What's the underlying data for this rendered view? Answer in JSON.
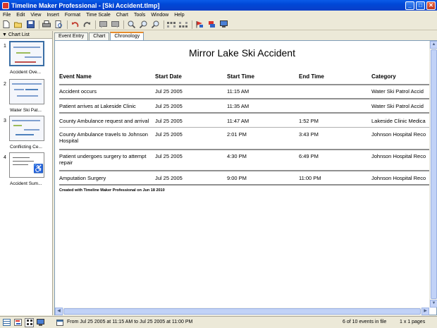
{
  "window": {
    "title": "Timeline Maker Professional - [Ski Accident.tlmp]",
    "buttons": [
      "_",
      "□",
      "✕"
    ]
  },
  "menu": [
    "File",
    "Edit",
    "View",
    "Insert",
    "Format",
    "Time Scale",
    "Chart",
    "Tools",
    "Window",
    "Help"
  ],
  "toolbar": {
    "icons": [
      "new-file-icon",
      "open-folder-icon",
      "save-icon",
      "print-icon",
      "print-preview-icon",
      "undo-icon",
      "redo-icon",
      "comment-icon",
      "comment-delete-icon",
      "search-icon",
      "zoom-in-icon",
      "zoom-out-icon",
      "expand-rows-icon",
      "collapse-rows-icon",
      "flag-icon",
      "export-icon",
      "monitor-icon"
    ]
  },
  "chart_list": {
    "header": "Chart List",
    "items": [
      {
        "num": "1",
        "label": "Accident Ove...",
        "selected": true
      },
      {
        "num": "2",
        "label": "Water Ski Pat...",
        "selected": false
      },
      {
        "num": "3",
        "label": "Conflicting Ce...",
        "selected": false
      },
      {
        "num": "4",
        "label": "Accident Sum...",
        "selected": false
      }
    ]
  },
  "tabs": [
    {
      "label": "Event Entry",
      "active": false
    },
    {
      "label": "Chart",
      "active": false
    },
    {
      "label": "Chronology",
      "active": true
    }
  ],
  "document": {
    "title": "Mirror Lake Ski Accident",
    "columns": [
      "Event Name",
      "Start Date",
      "Start Time",
      "End Time",
      "Category"
    ],
    "rows": [
      [
        "Accident occurs",
        "Jul 25 2005",
        "11:15 AM",
        "",
        "Water Ski Patrol Accid"
      ],
      [
        "Patient arrives at Lakeside Clinic",
        "Jul 25 2005",
        "11:35 AM",
        "",
        "Water Ski Patrol Accid"
      ],
      [
        "County Ambulance request and arrival",
        "Jul 25 2005",
        "11:47 AM",
        "1:52 PM",
        "Lakeside Clinic Medica"
      ],
      [
        "County Ambulance travels to Johnson Hospital",
        "Jul 25 2005",
        "2:01 PM",
        "3:43 PM",
        "Johnson Hospital Reco"
      ],
      [
        "Patient undergoes surgery to attempt repair",
        "Jul 25 2005",
        "4:30 PM",
        "6:49 PM",
        "Johnson Hospital Reco"
      ],
      [
        "Amputation Surgery",
        "Jul 25 2005",
        "9:00 PM",
        "11:00 PM",
        "Johnson Hospital Reco"
      ]
    ],
    "footer_note": "Created with Timeline Maker Professional on Jun 18 2010"
  },
  "statusbar": {
    "range": "From Jul 25 2005 at 11:15 AM to Jul 25 2005 at 11:00 PM",
    "events": "6 of 10 events in file",
    "pages": "1 x 1 pages"
  }
}
